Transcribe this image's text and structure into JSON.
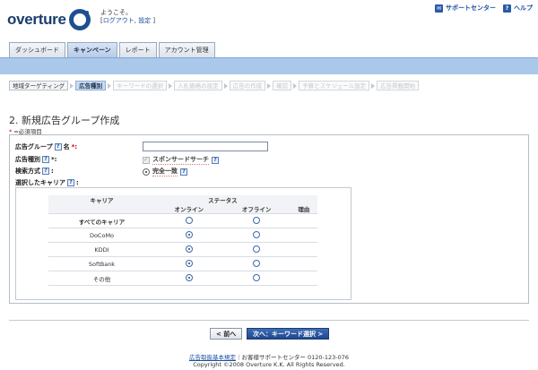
{
  "brand": {
    "name": "overture"
  },
  "welcome": {
    "greeting": "ようこそ。",
    "bracket_open": "[",
    "logout": "ログアウト",
    "comma": ", ",
    "settings": "設定",
    "bracket_close": " ]"
  },
  "util": {
    "support": "サポートセンター",
    "help": "ヘルプ"
  },
  "tabs": [
    {
      "label": "ダッシュボード"
    },
    {
      "label": "キャンペーン"
    },
    {
      "label": "レポート"
    },
    {
      "label": "アカウント管理"
    }
  ],
  "steps": [
    {
      "label": "地域ターゲティング"
    },
    {
      "label": "広告種別"
    },
    {
      "label": "キーワードの選択"
    },
    {
      "label": "入札価格の設定"
    },
    {
      "label": "広告の作成"
    },
    {
      "label": "確認"
    },
    {
      "label": "予算とスケジュール設定"
    },
    {
      "label": "広告掲載開始"
    }
  ],
  "page": {
    "title": "2. 新規広告グループ作成",
    "required_star": "*",
    "required_note": " =必須項目"
  },
  "form": {
    "group_name_label": "広告グループ",
    "name_label": " 名",
    "name_star": " *:",
    "group_name_value": "",
    "ad_type_label": "広告種別",
    "ad_type_suffix": "*:",
    "ad_type_option": "スポンサードサーチ",
    "search_method_label": "検索方式",
    "search_method_suffix": ":",
    "search_method_option": "完全一致",
    "carrier_label": "選択したキャリア",
    "carrier_suffix": ":"
  },
  "carrier_table": {
    "col_carrier": "キャリア",
    "col_status": "ステータス",
    "col_online": "オンライン",
    "col_offline": "オフライン",
    "col_reason": "理由",
    "rows": [
      {
        "name": "すべてのキャリア",
        "online": false,
        "offline": false
      },
      {
        "name": "DoCoMo",
        "online": true,
        "offline": false
      },
      {
        "name": "KDDI",
        "online": true,
        "offline": false
      },
      {
        "name": "SoftBank",
        "online": true,
        "offline": false
      },
      {
        "name": "その他",
        "online": true,
        "offline": false
      }
    ]
  },
  "buttons": {
    "back": "< 前へ",
    "next": "次へ：キーワード選択 >"
  },
  "footer": {
    "terms": "広告取扱基本規定",
    "sep": "｜",
    "support_line": "お客様サポートセンター 0120-123-076",
    "copyright": "Copyright ©2008 Overture K.K. All Rights Reserved."
  },
  "colors": {
    "accent_blue": "#a9c8ea",
    "link": "#1a4fa0",
    "primary_button": "#1e478f"
  }
}
